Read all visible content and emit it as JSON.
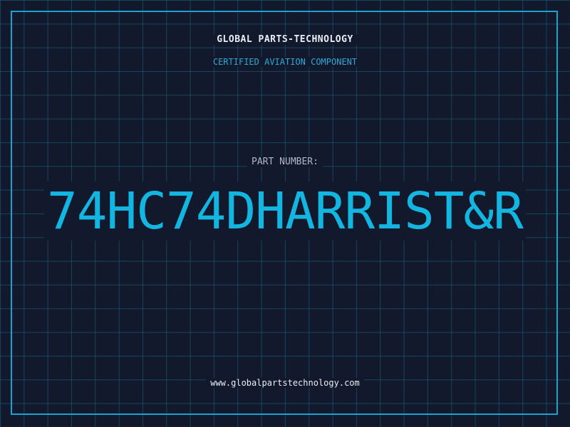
{
  "header": {
    "company": "GLOBAL PARTS-TECHNOLOGY",
    "subtitle": "CERTIFIED AVIATION COMPONENT"
  },
  "part": {
    "label": "PART NUMBER:",
    "number": "74HC74DHARRIST&R"
  },
  "footer": {
    "website": "www.globalpartstechnology.com"
  },
  "colors": {
    "background": "#12192c",
    "grid": "#1c7896",
    "accent": "#12b6e0",
    "frame": "#1aa3cf",
    "text": "#e8eef6"
  }
}
